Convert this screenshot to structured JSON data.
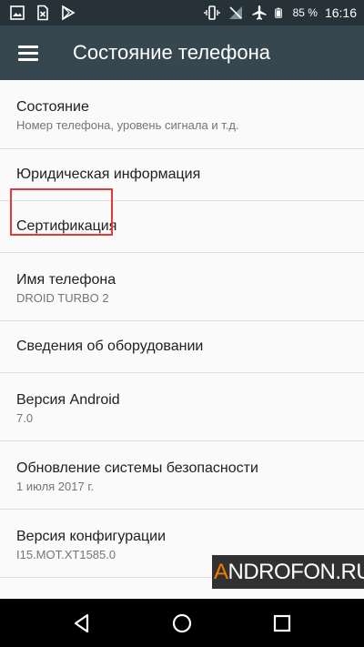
{
  "status_bar": {
    "left_icons": [
      "photo-icon",
      "sim-card-icon",
      "play-store-icon"
    ],
    "right_icons": [
      "vibrate-icon",
      "no-signal-icon",
      "airplane-mode-icon",
      "battery-icon"
    ],
    "battery": "85 %",
    "time": "16:16"
  },
  "app_bar": {
    "title": "Состояние телефона"
  },
  "items": [
    {
      "title": "Состояние",
      "subtitle": "Номер телефона, уровень сигнала и т.д."
    },
    {
      "title": "Юридическая информация"
    },
    {
      "title": "Сертификация"
    },
    {
      "title": "Имя телефона",
      "subtitle": "DROID TURBO 2",
      "highlighted": true
    },
    {
      "title": "Сведения об оборудовании"
    },
    {
      "title": "Версия Android",
      "subtitle": "7.0"
    },
    {
      "title": "Обновление системы безопасности",
      "subtitle": "1 июля 2017 г."
    },
    {
      "title": "Версия конфигурации",
      "subtitle": "I15.MOT.XT1585.0"
    }
  ],
  "watermark": {
    "first_letter": "A",
    "rest": "NDROFON.RU"
  },
  "nav_bar": {
    "buttons": [
      "back-icon",
      "home-icon",
      "recents-icon"
    ]
  },
  "colors": {
    "status_bar": "#263238",
    "app_bar": "#37474f",
    "highlight": "#e53935",
    "watermark_accent": "#f57c00"
  }
}
